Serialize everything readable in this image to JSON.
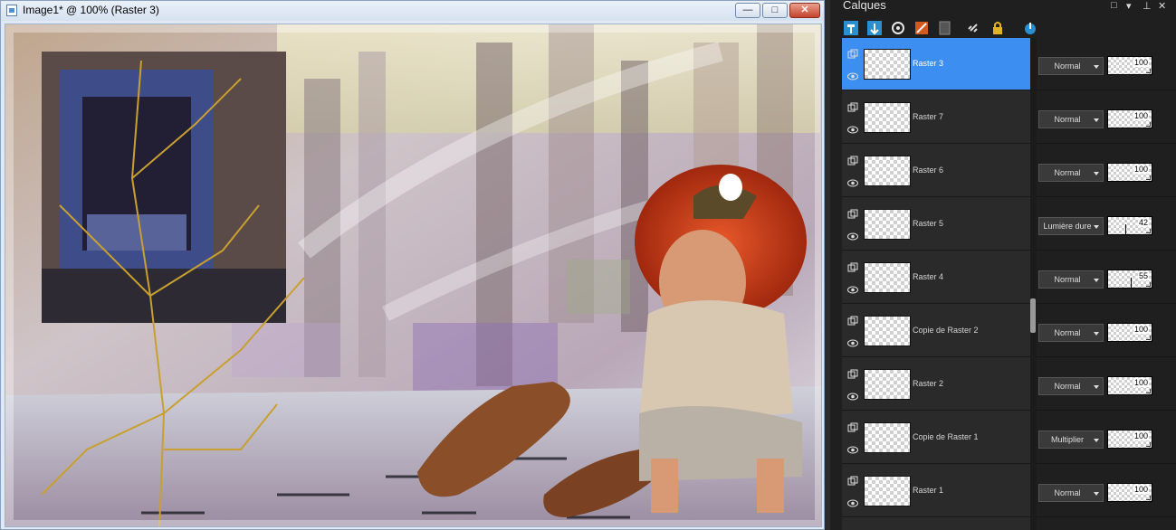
{
  "image_window": {
    "title": "Image1* @ 100% (Raster 3)",
    "buttons": {
      "minimize": "—",
      "maximize": "□",
      "close": "✕"
    }
  },
  "layers_panel": {
    "title": "Calques",
    "controls": {
      "restore": "□",
      "dropdown": "▾",
      "pin": "⊥",
      "close": "✕"
    },
    "toolbar_icons": [
      "new-raster-layer-icon",
      "new-vector-layer-icon",
      "mask-icon",
      "adjustment-layer-icon",
      "group-icon",
      "link-icon",
      "lock-icon",
      "delete-icon"
    ],
    "layers": [
      {
        "name": "Raster 3",
        "blend": "Normal",
        "opacity": "100",
        "selected": true
      },
      {
        "name": "Raster 7",
        "blend": "Normal",
        "opacity": "100",
        "selected": false
      },
      {
        "name": "Raster 6",
        "blend": "Normal",
        "opacity": "100",
        "selected": false
      },
      {
        "name": "Raster 5",
        "blend": "Lumière dure",
        "opacity": "42",
        "selected": false
      },
      {
        "name": "Raster 4",
        "blend": "Normal",
        "opacity": "55",
        "selected": false
      },
      {
        "name": "Copie de Raster 2",
        "blend": "Normal",
        "opacity": "100",
        "selected": false
      },
      {
        "name": "Raster 2",
        "blend": "Normal",
        "opacity": "100",
        "selected": false
      },
      {
        "name": "Copie de Raster 1",
        "blend": "Multiplier",
        "opacity": "100",
        "selected": false
      },
      {
        "name": "Raster 1",
        "blend": "Normal",
        "opacity": "100",
        "selected": false
      }
    ]
  }
}
